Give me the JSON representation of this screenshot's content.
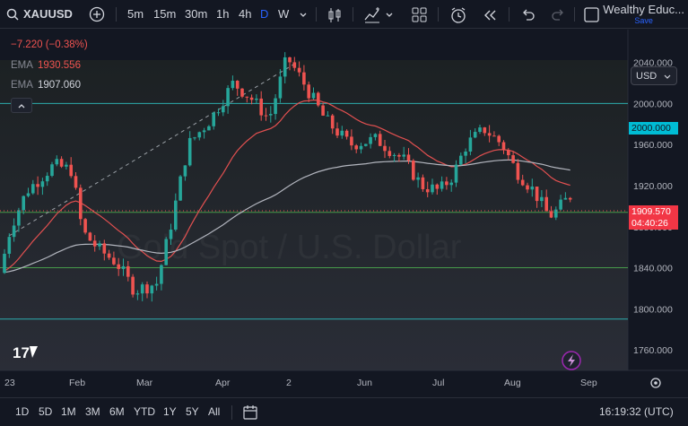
{
  "toolbar": {
    "symbol": "XAUUSD",
    "intervals": [
      "5m",
      "15m",
      "30m",
      "1h",
      "4h",
      "D",
      "W"
    ],
    "active_interval": "D",
    "account_name": "Wealthy Educ...",
    "save_label": "Save"
  },
  "legend": {
    "change": "−7.220 (−0.38%)",
    "ema1_label": "EMA",
    "ema1_value": "1930.556",
    "ema2_label": "EMA",
    "ema2_value": "1907.060"
  },
  "currency_select": "USD",
  "watermark": "Gold Spot / U.S. Dollar",
  "price_tags": {
    "level": "2000.000",
    "last": "1909.570",
    "countdown": "04:40:26"
  },
  "chart_data": {
    "type": "candlestick",
    "y_ticks": [
      "2040.000",
      "2000.000",
      "1960.000",
      "1920.000",
      "1880.000",
      "1840.000",
      "1800.000",
      "1760.000"
    ],
    "x_ticks": [
      "23",
      "Feb",
      "Mar",
      "Apr",
      "2",
      "Jun",
      "Jul",
      "Aug",
      "Sep"
    ],
    "ylim": [
      1740,
      2072
    ],
    "horizontal_levels": [
      2000,
      1894,
      1840,
      1790
    ],
    "last_price": 1909.57,
    "start_close": 1835,
    "colors": {
      "up": "#26a69a",
      "down": "#ef5350",
      "ema_fast": "#e25050",
      "ema_slow": "#b2b5be",
      "level": "#2ec4c4",
      "grid_level": "#4caf50"
    }
  },
  "bottom": {
    "ranges": [
      "1D",
      "5D",
      "1M",
      "3M",
      "6M",
      "YTD",
      "1Y",
      "5Y",
      "All"
    ],
    "clock": "16:19:32 (UTC)"
  },
  "colors": {
    "accent": "#2962ff",
    "bg": "#131722"
  }
}
